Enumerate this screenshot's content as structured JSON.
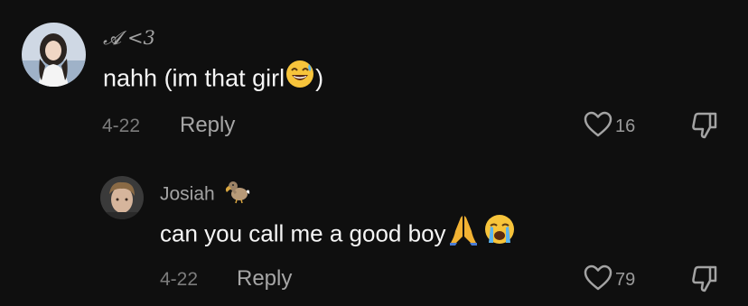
{
  "comments": [
    {
      "username": "𝓐 <3",
      "text": "nahh (im that girl",
      "text_suffix": ")",
      "emoji": "sweat-smile-emoji",
      "date": "4-22",
      "reply_label": "Reply",
      "likes": "16"
    },
    {
      "username": "Josiah",
      "username_emoji": "dodo-emoji",
      "text": "can you call me a good boy",
      "emojis": [
        "folded-hands-emoji",
        "loudly-crying-emoji"
      ],
      "date": "4-22",
      "reply_label": "Reply",
      "likes": "79"
    }
  ],
  "icons": {
    "like": "heart-outline-icon",
    "dislike": "thumbs-down-outline-icon"
  },
  "colors": {
    "background": "#0f0f0f",
    "text": "#f5f5f5",
    "muted": "#7c7c7c"
  }
}
